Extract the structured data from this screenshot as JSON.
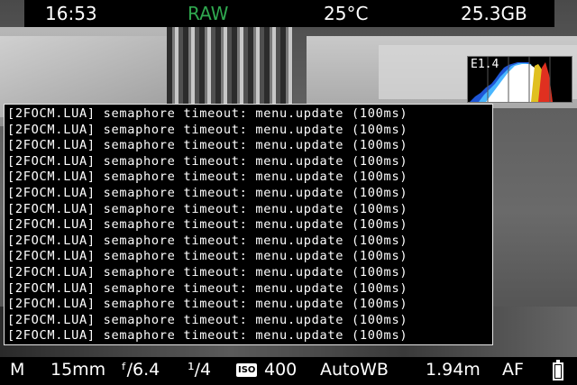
{
  "top_bar": {
    "time": "16:53",
    "format": "RAW",
    "format_color": "#2fa84f",
    "temperature": "25°C",
    "card_free": "25.3GB"
  },
  "histogram": {
    "ev_label": "E1.4"
  },
  "console": {
    "lines": [
      "[2FOCM.LUA] semaphore timeout: menu.update (100ms)",
      "[2FOCM.LUA] semaphore timeout: menu.update (100ms)",
      "[2FOCM.LUA] semaphore timeout: menu.update (100ms)",
      "[2FOCM.LUA] semaphore timeout: menu.update (100ms)",
      "[2FOCM.LUA] semaphore timeout: menu.update (100ms)",
      "[2FOCM.LUA] semaphore timeout: menu.update (100ms)",
      "[2FOCM.LUA] semaphore timeout: menu.update (100ms)",
      "[2FOCM.LUA] semaphore timeout: menu.update (100ms)",
      "[2FOCM.LUA] semaphore timeout: menu.update (100ms)",
      "[2FOCM.LUA] semaphore timeout: menu.update (100ms)",
      "[2FOCM.LUA] semaphore timeout: menu.update (100ms)",
      "[2FOCM.LUA] semaphore timeout: menu.update (100ms)",
      "[2FOCM.LUA] semaphore timeout: menu.update (100ms)",
      "[2FOCM.LUA] semaphore timeout: menu.update (100ms)",
      "[2FOCM.LUA] semaphore timeout: menu.update (100ms)"
    ]
  },
  "bottom_bar": {
    "mode": "M",
    "focal_length": "15mm",
    "aperture": "ᶠ/6.4",
    "shutter": "¹/4",
    "iso_icon": "ISO",
    "iso": "400",
    "white_balance": "AutoWB",
    "focus_distance": "1.94m",
    "focus_mode": "AF",
    "battery_icon": "battery-icon",
    "battery_level": 0.85
  }
}
